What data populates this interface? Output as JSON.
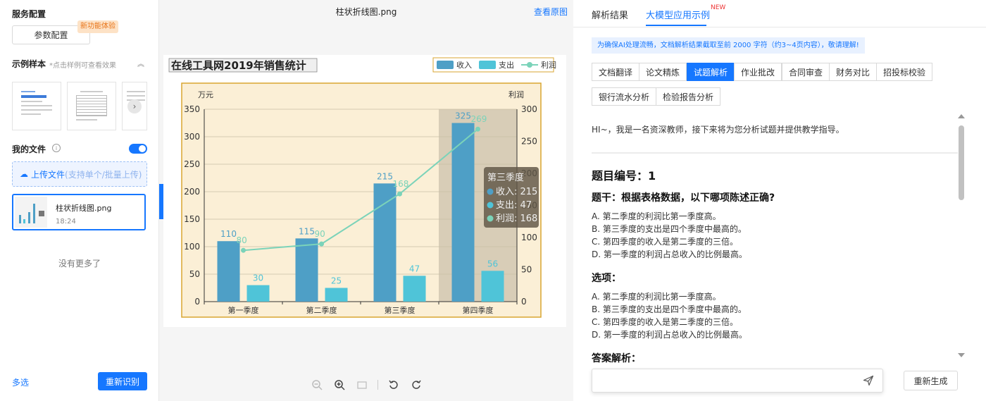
{
  "left": {
    "service_title": "服务配置",
    "param_button": "参数配置",
    "new_badge": "新功能体验",
    "sample_title": "示例样本",
    "sample_hint": "*点击样例可查看效果",
    "myfiles_title": "我的文件",
    "upload_label": "上传文件",
    "upload_sub": "(支持单个/批量上传)",
    "file": {
      "name": "柱状折线图.png",
      "time": "18:24"
    },
    "no_more": "没有更多了",
    "multi_select": "多选",
    "recognize_button": "重新识别",
    "toggle_on": true
  },
  "middle": {
    "title": "柱状折线图.png",
    "view_original": "查看原图",
    "toolbar_icons": [
      "zoom-out-icon",
      "zoom-in-icon",
      "fit-icon",
      "rotate-left-icon",
      "rotate-right-icon"
    ]
  },
  "chart_data": {
    "type": "bar",
    "title": "在线工具网2019年销售统计",
    "categories": [
      "第一季度",
      "第二季度",
      "第三季度",
      "第四季度"
    ],
    "series": [
      {
        "name": "收入",
        "type": "bar",
        "axis": "left",
        "values": [
          110,
          115,
          215,
          325
        ],
        "color": "#4e9fc6"
      },
      {
        "name": "支出",
        "type": "bar",
        "axis": "left",
        "values": [
          30,
          25,
          47,
          56
        ],
        "color": "#4fc4d8"
      },
      {
        "name": "利润",
        "type": "line",
        "axis": "right",
        "values": [
          80,
          90,
          168,
          269
        ],
        "color": "#7bd3b9"
      }
    ],
    "y_left": {
      "label": "万元",
      "min": 0,
      "max": 350,
      "ticks": [
        0,
        50,
        100,
        150,
        200,
        250,
        300,
        350
      ]
    },
    "y_right": {
      "label": "利润",
      "min": 0,
      "max": 300,
      "ticks": [
        0,
        50,
        100,
        150,
        200,
        250,
        300
      ]
    },
    "legend": "top-right",
    "highlighted_category_index": 3,
    "tooltip": {
      "title": "第三季度",
      "rows": [
        {
          "label": "收入",
          "value": "215"
        },
        {
          "label": "支出",
          "value": "47"
        },
        {
          "label": "利润",
          "value": "168"
        }
      ]
    },
    "grid": true
  },
  "right": {
    "tab_parse": "解析结果",
    "tab_llm": "大模型应用示例",
    "new_tag": "NEW",
    "notice": "为确保AI处理流畅，文档解析结果截取至前 2000 字符（约3~4页内容），敬请理解!",
    "functions": [
      "文档翻译",
      "论文精炼",
      "试题解析",
      "作业批改",
      "合同审查",
      "财务对比",
      "招投标校验",
      "银行流水分析",
      "检验报告分析"
    ],
    "active_function": "试题解析",
    "greeting": "HI~，我是一名资深教师，接下来将为您分析试题并提供教学指导。",
    "question_no": "题目编号：1",
    "stem": "题干：根据表格数据，以下哪项陈述正确?",
    "stem_options": [
      "A. 第二季度的利润比第一季度高。",
      "B. 第三季度的支出是四个季度中最高的。",
      "C. 第四季度的收入是第二季度的三倍。",
      "D. 第一季度的利润占总收入的比例最高。"
    ],
    "options_title": "选项：",
    "options": [
      "A. 第二季度的利润比第一季度高。",
      "B. 第三季度的支出是四个季度中最高的。",
      "C. 第四季度的收入是第二季度的三倍。",
      "D. 第一季度的利润占总收入的比例最高。"
    ],
    "answer_title": "答案解析：",
    "regen_button": "重新生成"
  }
}
